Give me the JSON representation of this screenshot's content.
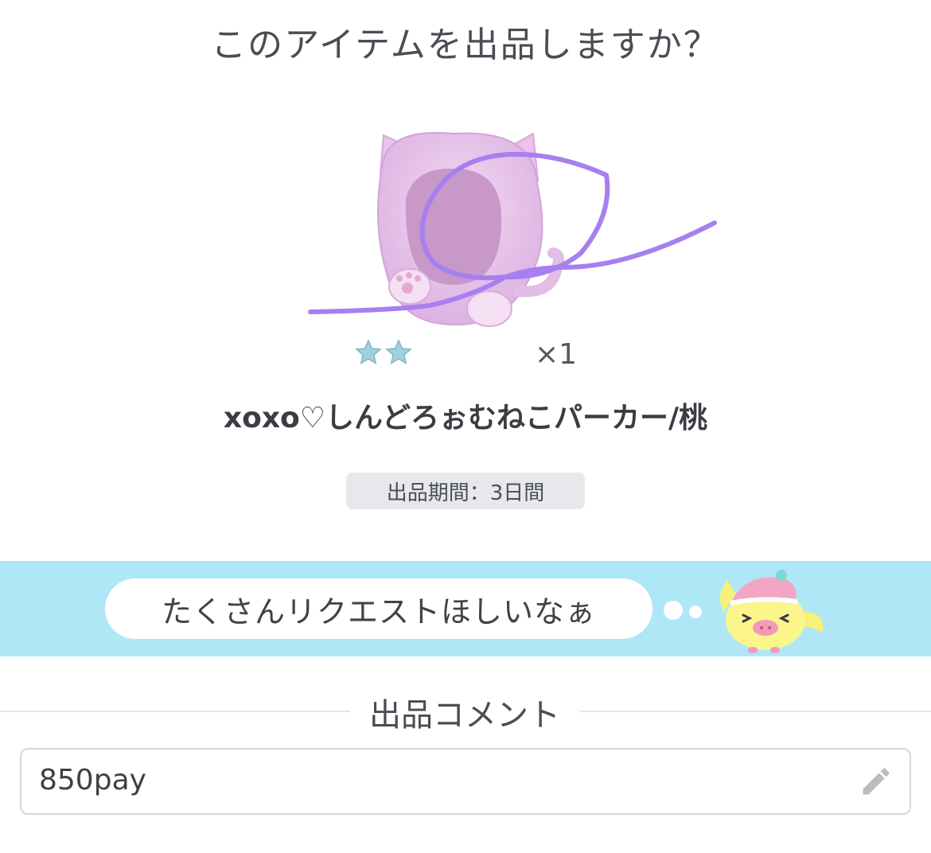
{
  "dialog": {
    "title": "このアイテムを出品しますか？"
  },
  "item": {
    "name": "xoxo♡しんどろぉむねこパーカー/桃",
    "quantity": "×1",
    "rarity_stars": 2,
    "icon": "pink-cat-hoodie-icon"
  },
  "listing": {
    "period": "出品期間：3日間"
  },
  "banner": {
    "message": "たくさんリクエストほしいなぁ",
    "mascot_icon": "yellow-bird-mascot-icon"
  },
  "comment": {
    "label": "出品コメント",
    "value": "850pay",
    "edit_icon": "pencil-icon"
  },
  "colors": {
    "banner_bg": "#afe7f7",
    "badge_bg": "#e6e8eb",
    "scribble": "#a77ff0"
  }
}
